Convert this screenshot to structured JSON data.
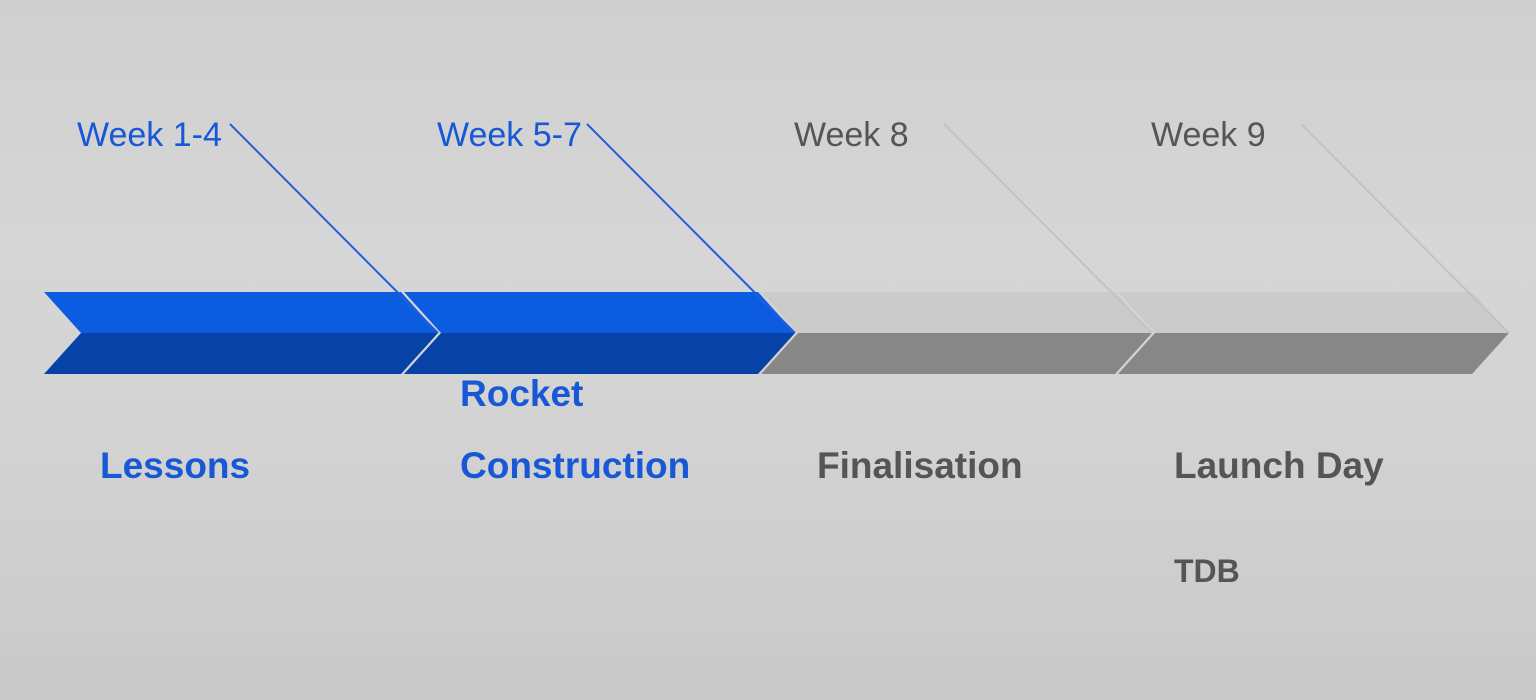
{
  "colors": {
    "active_top": "#0b5ce0",
    "active_bottom": "#0742a6",
    "inactive_top": "#cbcbcb",
    "inactive_bottom": "#878787",
    "active_text": "#1857d6",
    "inactive_text": "#555555",
    "active_leader": "#1f5fd8",
    "inactive_leader": "#c3c3c3"
  },
  "phases": [
    {
      "week": "Week 1-4",
      "title_lines": [
        "Lessons"
      ],
      "note": "",
      "status": "active"
    },
    {
      "week": "Week 5-7",
      "title_lines": [
        "Rocket",
        "Construction"
      ],
      "note": "",
      "status": "active"
    },
    {
      "week": "Week 8",
      "title_lines": [
        "Finalisation"
      ],
      "note": "",
      "status": "inactive"
    },
    {
      "week": "Week 9",
      "title_lines": [
        "Launch Day"
      ],
      "note": "TDB",
      "status": "inactive"
    }
  ]
}
